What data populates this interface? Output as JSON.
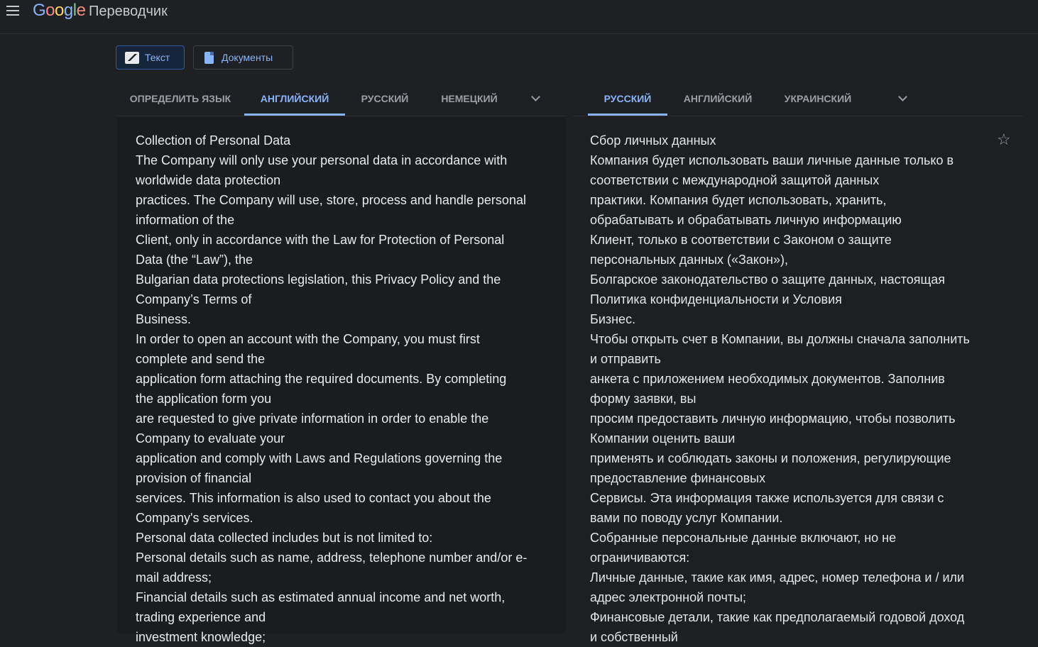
{
  "header": {
    "logo_text": "Google",
    "app_name": "Переводчик"
  },
  "modes": {
    "text_label": "Текст",
    "documents_label": "Документы"
  },
  "source_langs": {
    "tabs": [
      "ОПРЕДЕЛИТЬ ЯЗЫК",
      "АНГЛИЙСКИЙ",
      "РУССКИЙ",
      "НЕМЕЦКИЙ"
    ],
    "active": "АНГЛИЙСКИЙ"
  },
  "target_langs": {
    "tabs": [
      "РУССКИЙ",
      "АНГЛИЙСКИЙ",
      "УКРАИНСКИЙ"
    ],
    "active": "РУССКИЙ"
  },
  "source_text": [
    "Collection of Personal Data",
    "The Company will only use your personal data in accordance with",
    "worldwide data protection",
    "practices. The Company will use, store, process and handle personal",
    "information of the",
    "Client, only in accordance with the Law for Protection of Personal",
    "Data (the “Law”), the",
    "Bulgarian data protections legislation, this Privacy Policy and the",
    "Company’s Terms of",
    "Business.",
    "In order to open an account with the Company, you must first",
    "complete and send the",
    "application form attaching the required documents. By completing",
    "the application form you",
    "are requested to give private information in order to enable the",
    "Company to evaluate your",
    "application and comply with Laws and Regulations governing the",
    "provision of financial",
    "services. This information is also used to contact you about the",
    "Company's services.",
    "Personal data collected includes but is not limited to:",
    "Personal details such as name, address, telephone number and/or e-",
    "mail address;",
    "Financial details such as estimated annual income and net worth,",
    "trading experience and",
    "investment knowledge;"
  ],
  "translated_text": [
    "Сбор личных данных",
    "Компания будет использовать ваши личные данные только в",
    "соответствии с международной защитой данных",
    "практики. Компания будет использовать, хранить,",
    "обрабатывать и обрабатывать личную информацию",
    "Клиент, только в соответствии с Законом о защите",
    "персональных данных («Закон»),",
    "Болгарское законодательство о защите данных, настоящая",
    "Политика конфиденциальности и Условия",
    "Бизнес.",
    "Чтобы открыть счет в Компании, вы должны сначала заполнить",
    "и отправить",
    "анкета с приложением необходимых документов. Заполнив",
    "форму заявки, вы",
    "просим предоставить личную информацию, чтобы позволить",
    "Компании оценить ваши",
    "применять и соблюдать законы и положения, регулирующие",
    "предоставление финансовых",
    "Сервисы. Эта информация также используется для связи с",
    "вами по поводу услуг Компании.",
    "Собранные персональные данные включают, но не",
    "ограничиваются:",
    "Личные данные, такие как имя, адрес, номер телефона и / или",
    "адрес электронной почты;",
    "Финансовые детали, такие как предполагаемый годовой доход",
    "и собственный"
  ],
  "icons": {
    "menu": "hamburger-menu-icon",
    "text_mode": "translate-text-icon",
    "documents_mode": "document-icon",
    "more_langs": "chevron-down-icon",
    "save": "star-outline-icon"
  },
  "colors": {
    "background": "#1f2023",
    "accent": "#8ab4f8",
    "text": "#e8eaed",
    "muted": "#9aa0a6"
  }
}
